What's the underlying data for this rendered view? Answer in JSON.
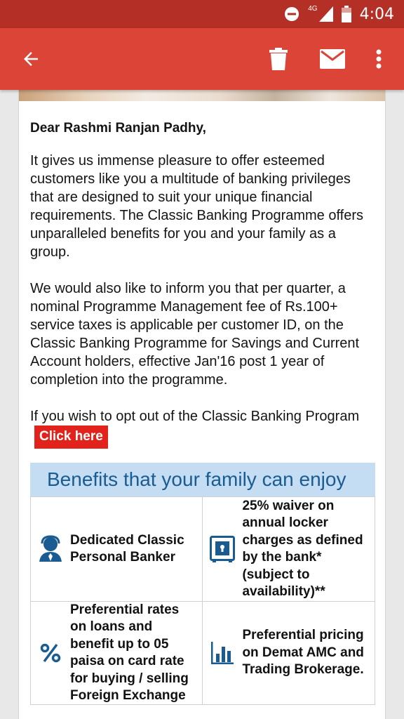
{
  "status_bar": {
    "network": "4G",
    "time": "4:04"
  },
  "app_bar": {
    "icons": [
      "back-arrow-icon",
      "delete-icon",
      "mail-icon",
      "more-vert-icon"
    ]
  },
  "colors": {
    "status_bar": "#b42f25",
    "app_bar": "#db4437",
    "click_here": "#e1231c",
    "benefits_header_bg": "#c5ddf3",
    "benefits_header_text": "#1a5c92",
    "icon_blue": "#1a5c92"
  },
  "email": {
    "salutation": "Dear Rashmi Ranjan Padhy,",
    "paragraph1": "It gives us immense pleasure to offer esteemed customers like you a multitude of banking privileges that are designed to suit your unique financial requirements. The Classic Banking Programme offers unparalleled benefits for you and your family as a group.",
    "paragraph2": "We would also like to inform you that per quarter, a nominal Programme Management fee of Rs.100+ service taxes is applicable per customer ID, on the Classic Banking Programme for Savings and Current Account holders, effective Jan'16 post 1 year of completion into the programme.",
    "optout_text": "If you wish to opt out of the Classic Banking Program",
    "click_here_label": "Click here"
  },
  "benefits": {
    "title": "Benefits that your family can enjoy",
    "items": [
      {
        "icon": "banker-person-icon",
        "text": "Dedicated Classic Personal Banker"
      },
      {
        "icon": "locker-safe-icon",
        "text": "25% waiver on annual locker charges as defined by the bank* (subject to availability)**"
      },
      {
        "icon": "percent-icon",
        "text": "Preferential rates on loans and benefit up to 05 paisa on card rate for buying / selling Foreign Exchange"
      },
      {
        "icon": "bar-chart-icon",
        "text": "Preferential pricing on Demat AMC and Trading Brokerage."
      }
    ]
  }
}
